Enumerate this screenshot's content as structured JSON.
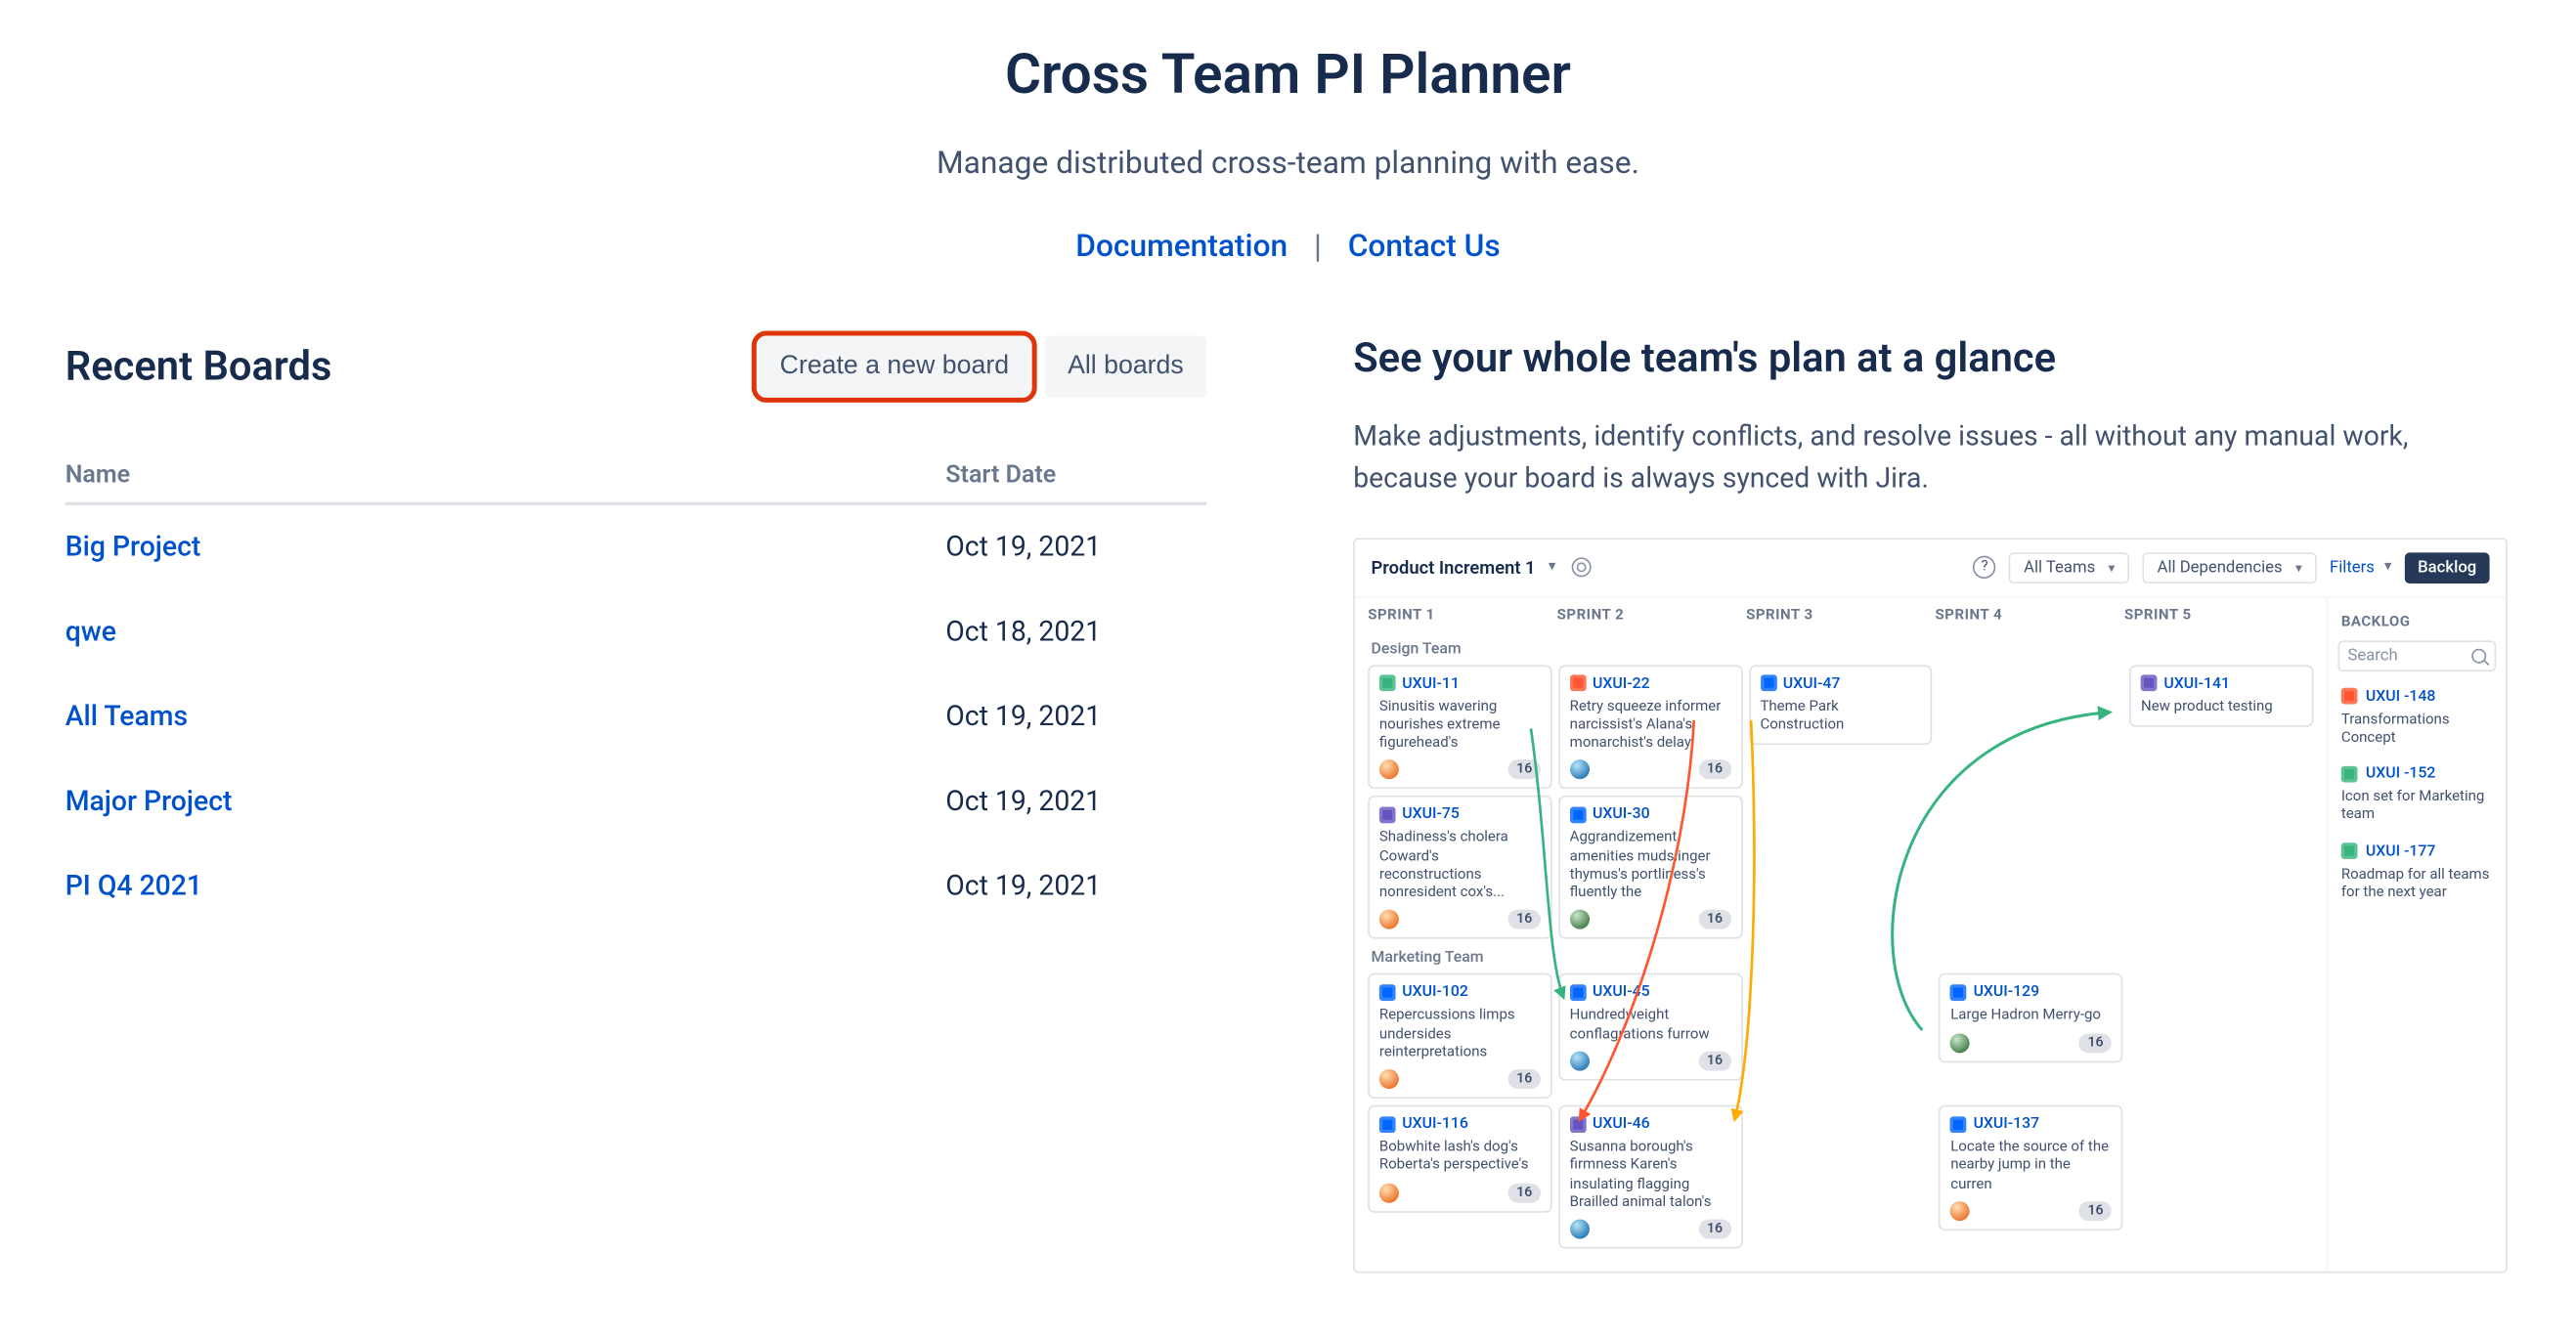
{
  "hero": {
    "title": "Cross Team PI Planner",
    "subtitle": "Manage distributed cross-team planning with ease.",
    "doc_link": "Documentation",
    "contact_link": "Contact Us",
    "sep": "|"
  },
  "left": {
    "heading": "Recent Boards",
    "create_btn": "Create a new board",
    "all_btn": "All boards",
    "col_name": "Name",
    "col_date": "Start Date",
    "boards": [
      {
        "name": "Big Project",
        "date": "Oct 19, 2021"
      },
      {
        "name": "qwe",
        "date": "Oct 18, 2021"
      },
      {
        "name": "All Teams",
        "date": "Oct 19, 2021"
      },
      {
        "name": "Major Project",
        "date": "Oct 19, 2021"
      },
      {
        "name": "PI Q4 2021",
        "date": "Oct 19, 2021"
      }
    ]
  },
  "right": {
    "heading": "See your whole team's plan at a glance",
    "body": "Make adjustments, identify conflicts, and resolve issues - all without any manual work, because your board is always synced with Jira."
  },
  "preview": {
    "toolbar": {
      "pi_title": "Product Increment 1",
      "help": "?",
      "all_teams": "All Teams",
      "all_deps": "All Dependencies",
      "filters": "Filters",
      "backlog_btn": "Backlog"
    },
    "sprint_heads": [
      "SPRINT 1",
      "SPRINT 2",
      "SPRINT 3",
      "SPRINT 4",
      "SPRINT 5"
    ],
    "backlog_head": "BACKLOG",
    "search_placeholder": "Search",
    "teams": {
      "design": "Design Team",
      "marketing": "Marketing Team"
    },
    "cards": {
      "d_s1_a": {
        "key": "UXUI-11",
        "summary": "Sinusitis wavering nourishes extreme figurehead's",
        "points": "16"
      },
      "d_s1_b": {
        "key": "UXUI-75",
        "summary": "Shadiness's cholera Coward's reconstructions nonresident cox's...",
        "points": "16"
      },
      "d_s2_a": {
        "key": "UXUI-22",
        "summary": "Retry squeeze informer narcissist's Alana's monarchist's delay",
        "points": "16"
      },
      "d_s2_b": {
        "key": "UXUI-30",
        "summary": "Aggrandizement amenities mudslinger thymus's portliness's fluently the",
        "points": "16"
      },
      "d_s3_a": {
        "key": "UXUI-47",
        "summary": "Theme Park Construction"
      },
      "d_s5_a": {
        "key": "UXUI-141",
        "summary": "New product testing"
      },
      "m_s1_a": {
        "key": "UXUI-102",
        "summary": "Repercussions limps undersides reinterpretations",
        "points": "16"
      },
      "m_s1_b": {
        "key": "UXUI-116",
        "summary": "Bobwhite lash's dog's Roberta's perspective's",
        "points": "16"
      },
      "m_s2_a": {
        "key": "UXUI-45",
        "summary": "Hundredweight conflagrations furrow",
        "points": "16"
      },
      "m_s2_b": {
        "key": "UXUI-46",
        "summary": "Susanna borough's firmness Karen's insulating flagging Brailled animal talon's",
        "points": "16"
      },
      "m_s4_a": {
        "key": "UXUI-129",
        "summary": "Large Hadron Merry-go",
        "points": "16"
      },
      "m_s4_b": {
        "key": "UXUI-137",
        "summary": "Locate the source of the nearby jump in the curren",
        "points": "16"
      }
    },
    "backlog": [
      {
        "key": "UXUI -148",
        "summary": "Transformations Concept",
        "type": "bug"
      },
      {
        "key": "UXUI -152",
        "summary": "Icon set for Marketing team",
        "type": "story"
      },
      {
        "key": "UXUI -177",
        "summary": "Roadmap for all teams for the next year",
        "type": "story"
      }
    ]
  }
}
